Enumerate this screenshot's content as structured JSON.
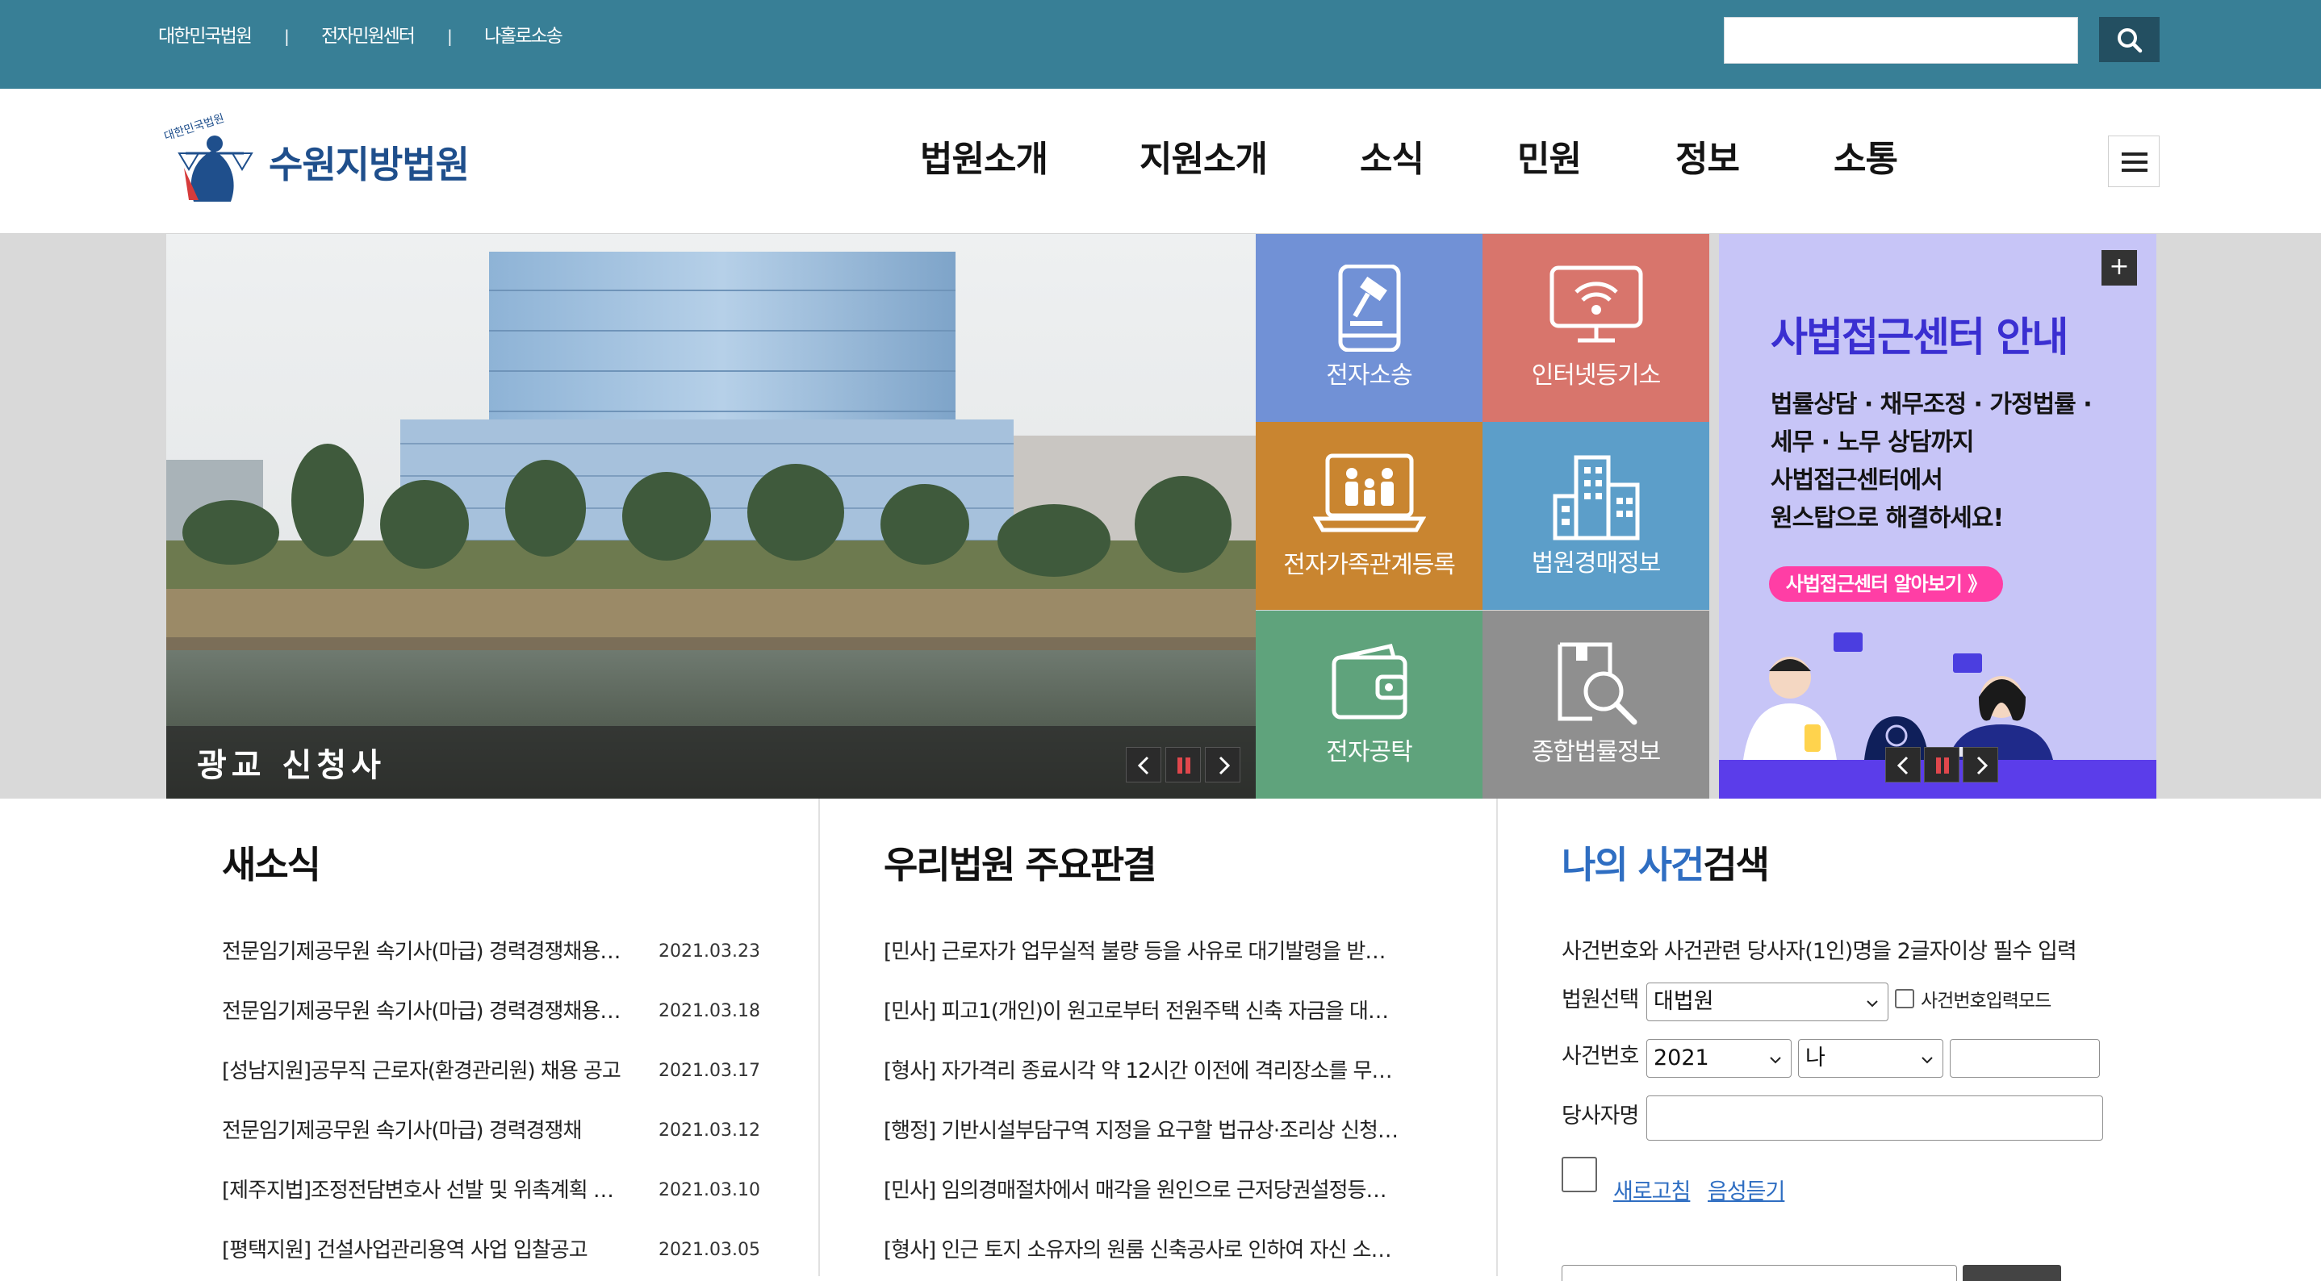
{
  "topbar": {
    "links": [
      "대한민국법원",
      "전자민원센터",
      "나홀로소송"
    ],
    "separator": "|",
    "search": {
      "value": "",
      "placeholder": ""
    },
    "search_icon": "search-icon"
  },
  "header": {
    "logo_text": "수원지방법원",
    "logo_emblem_text": "대한민국법원",
    "nav": [
      "법원소개",
      "지원소개",
      "소식",
      "민원",
      "정보",
      "소통"
    ],
    "menu_icon": "hamburger-icon"
  },
  "visual": {
    "slide_caption": "광교 신청사",
    "quick_links": [
      {
        "label": "전자소송",
        "icon": "e-litigation-gavel-icon",
        "color": "#7191d6"
      },
      {
        "label": "인터넷등기소",
        "icon": "internet-registry-monitor-icon",
        "color": "#d8756c"
      },
      {
        "label": "전자가족관계등록",
        "icon": "family-registry-icon",
        "color": "#c98530"
      },
      {
        "label": "법원경매정보",
        "icon": "auction-building-icon",
        "color": "#5c9ec9"
      },
      {
        "label": "전자공탁",
        "icon": "deposit-wallet-icon",
        "color": "#5fa37c"
      },
      {
        "label": "종합법률정보",
        "icon": "legal-info-search-icon",
        "color": "#8f8f8f"
      }
    ],
    "banner": {
      "title": "사법접근센터 안내",
      "body_lines": [
        "법률상담 · 채무조정 · 가정법률 ·",
        "세무 · 노무 상담까지",
        "사법접근센터에서",
        "원스탑으로 해결하세요!"
      ],
      "button": "사법접근센터 알아보기 》",
      "plus": "+"
    }
  },
  "news": {
    "title": "새소식",
    "items": [
      {
        "title": "전문임기제공무원 속기사(마급) 경력경쟁채용시험 공고",
        "date": "2021.03.23"
      },
      {
        "title": "전문임기제공무원 속기사(마급) 경력경쟁채용시험 합격자 공고",
        "date": "2021.03.18"
      },
      {
        "title": "[성남지원]공무직 근로자(환경관리원) 채용 공고",
        "date": "2021.03.17"
      },
      {
        "title": "전문임기제공무원 속기사(마급) 경력경쟁채",
        "date": "2021.03.12"
      },
      {
        "title": "[제주지법]조정전담변호사 선발 및 위촉계획 공고",
        "date": "2021.03.10"
      },
      {
        "title": "[평택지원] 건설사업관리용역 사업 입찰공고",
        "date": "2021.03.05"
      }
    ]
  },
  "rulings": {
    "title": "우리법원 주요판결",
    "items": [
      "[민사] 근로자가 업무실적 불량 등을 사유로 대기발령을 받고 …",
      "[민사] 피고1(개인)이 원고로부터 전원주택 신축 자금을 대여…",
      "[형사] 자가격리 종료시각 약 12시간 이전에 격리장소를 무단…",
      "[행정] 기반시설부담구역 지정을 요구할 법규상·조리상 신청…",
      "[민사] 임의경매절차에서 매각을 원인으로 근저당권설정등기…",
      "[형사] 인근 토지 소유자의 원룸 신축공사로 인하여 자신 소유…"
    ]
  },
  "case_search": {
    "title_highlight": "나의 사건",
    "title_rest": "검색",
    "notice": "사건번호와 사건관련 당사자(1인)명을 2글자이상 필수 입력",
    "court_label": "법원선택",
    "court_value": "대법원",
    "mode_label": "사건번호입력모드",
    "case_no_label": "사건번호",
    "year_value": "2021",
    "type_value": "나",
    "case_no_value": "",
    "party_label": "당사자명",
    "party_value": "",
    "refresh_link": "새로고침",
    "audio_link": "음성듣기"
  }
}
